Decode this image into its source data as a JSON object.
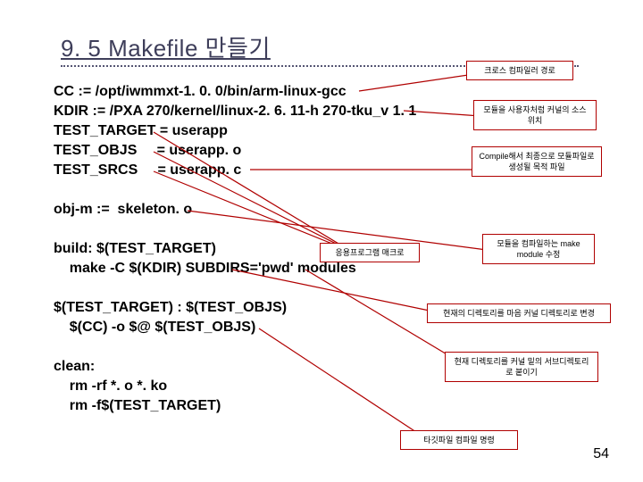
{
  "title": "9. 5  Makefile 만들기",
  "code": "CC := /opt/iwmmxt-1. 0. 0/bin/arm-linux-gcc\nKDIR := /PXA 270/kernel/linux-2. 6. 11-h 270-tku_v 1. 1\nTEST_TARGET = userapp\nTEST_OBJS     = userapp. o\nTEST_SRCS     = userapp. c\n\nobj-m :=  skeleton. o\n\nbuild: $(TEST_TARGET)\n    make -C $(KDIR) SUBDIRS='pwd' modules\n\n$(TEST_TARGET) : $(TEST_OBJS)\n    $(CC) -o $@ $(TEST_OBJS)\n\nclean:\n    rm -rf *. o *. ko\n    rm -f$(TEST_TARGET)",
  "callouts": {
    "c1": "크로스 컴파일러 경로",
    "c2": "모듈을 사용자처럼 커널의\n소스 위치",
    "c3": "Compile해서 최종으로\n모듈파일로 생성될\n목적 파일",
    "c4": "응용프로그램 매크로",
    "c5": "모듈을 컴파일하는\nmake module 수정",
    "c6": "현재의 디렉토리를 마음 커널 디렉토리로 변경",
    "c7": "현재 디렉토리를 커널 밑의\n서브디렉토리로 붙이기",
    "c8": "타깃파일 컴파일 명령"
  },
  "pagenum": "54"
}
